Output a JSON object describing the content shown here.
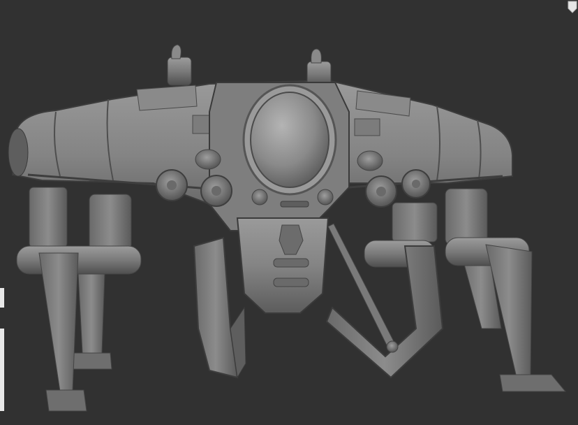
{
  "viewport": {
    "background": "#313131",
    "subject": "sculpted-robot-walker",
    "material": "matcap-grey"
  },
  "palette": {
    "highlight": "#a8a8a8",
    "base": "#7e7e7e",
    "shadow": "#4a4a4a",
    "dark": "#2a2a2a"
  }
}
